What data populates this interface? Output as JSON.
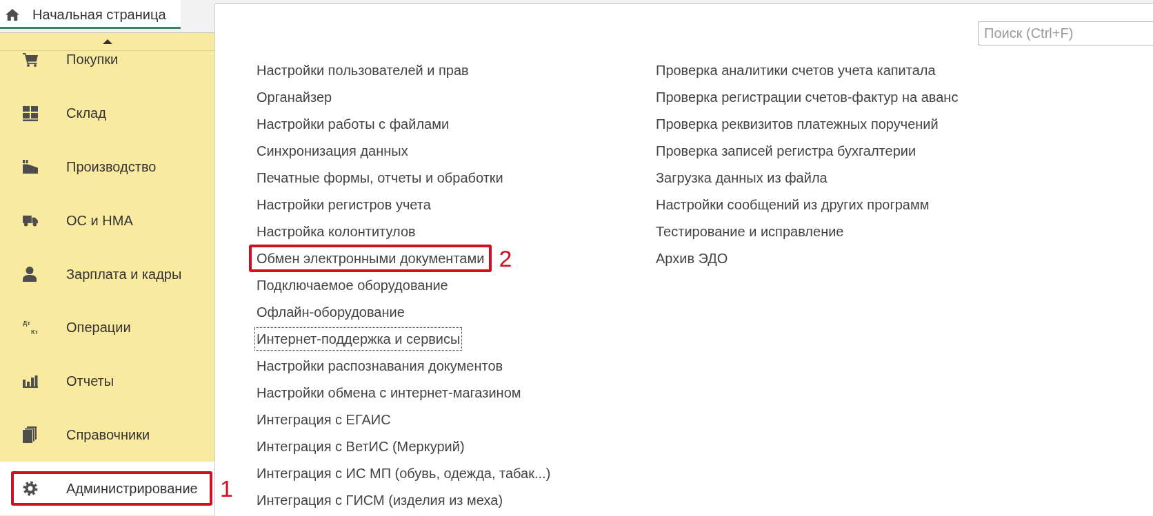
{
  "tabs": [
    {
      "label": "Начальная страница",
      "selected": true
    }
  ],
  "sidebar": {
    "sections": [
      {
        "label": "Покупки",
        "selected": false
      },
      {
        "label": "Склад",
        "selected": false
      },
      {
        "label": "Производство",
        "selected": false
      },
      {
        "label": "ОС и НМА",
        "selected": false
      },
      {
        "label": "Зарплата и кадры",
        "selected": false
      },
      {
        "label": "Операции",
        "selected": false,
        "icon_labels": [
          "Дт",
          "Кт"
        ]
      },
      {
        "label": "Отчеты",
        "selected": false
      },
      {
        "label": "Справочники",
        "selected": false
      },
      {
        "label": "Администрирование",
        "selected": true,
        "callout": "1"
      }
    ]
  },
  "search": {
    "placeholder": "Поиск (Ctrl+F)"
  },
  "links": {
    "columns": [
      [
        {
          "label": "Настройки пользователей и прав",
          "focused": false
        },
        {
          "label": "Органайзер",
          "focused": false
        },
        {
          "label": "Настройки работы с файлами",
          "focused": false
        },
        {
          "label": "Синхронизация данных",
          "focused": false
        },
        {
          "label": "Печатные формы, отчеты и обработки",
          "focused": false
        },
        {
          "label": "Настройки регистров учета",
          "focused": false
        },
        {
          "label": "Настройка колонтитулов",
          "focused": false
        },
        {
          "label": "Обмен электронными документами",
          "focused": false,
          "callout": "2"
        },
        {
          "label": "Подключаемое оборудование",
          "focused": false
        },
        {
          "label": "Офлайн-оборудование",
          "focused": false
        },
        {
          "label": "Интернет-поддержка и сервисы",
          "focused": true
        },
        {
          "label": "Настройки распознавания документов",
          "focused": false
        },
        {
          "label": "Настройки обмена с интернет-магазином",
          "focused": false
        },
        {
          "label": "Интеграция с ЕГАИС",
          "focused": false
        },
        {
          "label": "Интеграция с ВетИС (Меркурий)",
          "focused": false
        },
        {
          "label": "Интеграция с ИС МП (обувь, одежда, табак...)",
          "focused": false
        },
        {
          "label": "Интеграция с ГИСМ (изделия из меха)",
          "focused": false
        }
      ],
      [
        {
          "label": "Проверка аналитики счетов учета капитала",
          "focused": false
        },
        {
          "label": "Проверка регистрации счетов-фактур на аванс",
          "focused": false
        },
        {
          "label": "Проверка реквизитов платежных поручений",
          "focused": false
        },
        {
          "label": "Проверка записей регистра бухгалтерии",
          "focused": false
        },
        {
          "label": "Загрузка данных из файла",
          "focused": false
        },
        {
          "label": "Настройки сообщений из других программ",
          "focused": false
        },
        {
          "label": "Тестирование и исправление",
          "focused": false
        },
        {
          "label": "Архив ЭДО",
          "focused": false
        }
      ]
    ]
  }
}
